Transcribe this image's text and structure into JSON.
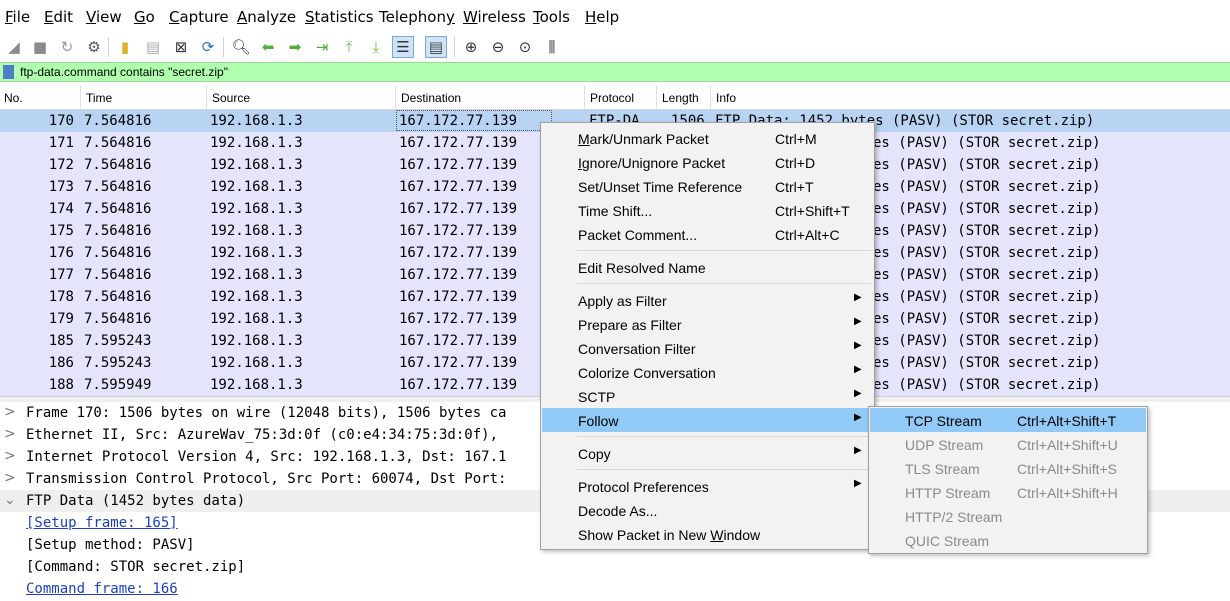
{
  "menubar": {
    "items": [
      {
        "pre": "",
        "ul": "F",
        "post": "ile"
      },
      {
        "pre": "",
        "ul": "E",
        "post": "dit"
      },
      {
        "pre": "",
        "ul": "V",
        "post": "iew"
      },
      {
        "pre": "",
        "ul": "G",
        "post": "o"
      },
      {
        "pre": "",
        "ul": "C",
        "post": "apture"
      },
      {
        "pre": "",
        "ul": "A",
        "post": "nalyze"
      },
      {
        "pre": "",
        "ul": "S",
        "post": "tatistics"
      },
      {
        "pre": "Telephon",
        "ul": "y",
        "post": ""
      },
      {
        "pre": "",
        "ul": "W",
        "post": "ireless"
      },
      {
        "pre": "",
        "ul": "T",
        "post": "ools"
      },
      {
        "pre": "",
        "ul": "H",
        "post": "elp"
      }
    ]
  },
  "filter": {
    "value": "ftp-data.command contains \"secret.zip\""
  },
  "columns": {
    "no": "No.",
    "time": "Time",
    "source": "Source",
    "destination": "Destination",
    "protocol": "Protocol",
    "length": "Length",
    "info": "Info"
  },
  "packets": [
    {
      "no": "170",
      "time": "7.564816",
      "src": "192.168.1.3",
      "dst": "167.172.77.139",
      "proto": "FTP-DA...",
      "len": "1506",
      "info": "FTP Data: 1452 bytes (PASV) (STOR secret.zip)"
    },
    {
      "no": "171",
      "time": "7.564816",
      "src": "192.168.1.3",
      "dst": "167.172.77.139",
      "proto": "",
      "len": "",
      "info": "es (PASV) (STOR secret.zip)"
    },
    {
      "no": "172",
      "time": "7.564816",
      "src": "192.168.1.3",
      "dst": "167.172.77.139",
      "proto": "",
      "len": "",
      "info": "es (PASV) (STOR secret.zip)"
    },
    {
      "no": "173",
      "time": "7.564816",
      "src": "192.168.1.3",
      "dst": "167.172.77.139",
      "proto": "",
      "len": "",
      "info": "es (PASV) (STOR secret.zip)"
    },
    {
      "no": "174",
      "time": "7.564816",
      "src": "192.168.1.3",
      "dst": "167.172.77.139",
      "proto": "",
      "len": "",
      "info": "es (PASV) (STOR secret.zip)"
    },
    {
      "no": "175",
      "time": "7.564816",
      "src": "192.168.1.3",
      "dst": "167.172.77.139",
      "proto": "",
      "len": "",
      "info": "es (PASV) (STOR secret.zip)"
    },
    {
      "no": "176",
      "time": "7.564816",
      "src": "192.168.1.3",
      "dst": "167.172.77.139",
      "proto": "",
      "len": "",
      "info": "es (PASV) (STOR secret.zip)"
    },
    {
      "no": "177",
      "time": "7.564816",
      "src": "192.168.1.3",
      "dst": "167.172.77.139",
      "proto": "",
      "len": "",
      "info": "es (PASV) (STOR secret.zip)"
    },
    {
      "no": "178",
      "time": "7.564816",
      "src": "192.168.1.3",
      "dst": "167.172.77.139",
      "proto": "",
      "len": "",
      "info": "es (PASV) (STOR secret.zip)"
    },
    {
      "no": "179",
      "time": "7.564816",
      "src": "192.168.1.3",
      "dst": "167.172.77.139",
      "proto": "",
      "len": "",
      "info": "es (PASV) (STOR secret.zip)"
    },
    {
      "no": "185",
      "time": "7.595243",
      "src": "192.168.1.3",
      "dst": "167.172.77.139",
      "proto": "",
      "len": "",
      "info": "es (PASV) (STOR secret.zip)"
    },
    {
      "no": "186",
      "time": "7.595243",
      "src": "192.168.1.3",
      "dst": "167.172.77.139",
      "proto": "",
      "len": "",
      "info": "es (PASV) (STOR secret.zip)"
    },
    {
      "no": "188",
      "time": "7.595949",
      "src": "192.168.1.3",
      "dst": "167.172.77.139",
      "proto": "",
      "len": "",
      "info": "es (PASV) (STOR secret.zip)"
    }
  ],
  "details": [
    {
      "text": "Frame 170: 1506 bytes on wire (12048 bits), 1506 bytes ca"
    },
    {
      "text": "Ethernet II, Src: AzureWav_75:3d:0f (c0:e4:34:75:3d:0f),"
    },
    {
      "text": "Internet Protocol Version 4, Src: 192.168.1.3, Dst: 167.1"
    },
    {
      "text": "Transmission Control Protocol, Src Port: 60074, Dst Port:"
    },
    {
      "text": "FTP Data (1452 bytes data)"
    },
    {
      "text": "[Setup frame: 165]"
    },
    {
      "text": "[Setup method: PASV]"
    },
    {
      "text": "[Command: STOR secret.zip]"
    },
    {
      "text": "Command frame: 166"
    }
  ],
  "context_menu": {
    "mark": {
      "pre": "",
      "ul": "M",
      "post": "ark/Unmark Packet",
      "shortcut": "Ctrl+M"
    },
    "ignore": {
      "pre": "",
      "ul": "I",
      "post": "gnore/Unignore Packet",
      "shortcut": "Ctrl+D"
    },
    "time_ref": {
      "label": "Set/Unset Time Reference",
      "shortcut": "Ctrl+T"
    },
    "time_shift": {
      "label": "Time Shift...",
      "shortcut": "Ctrl+Shift+T"
    },
    "comment": {
      "label": "Packet Comment...",
      "shortcut": "Ctrl+Alt+C"
    },
    "edit_resolved": {
      "label": "Edit Resolved Name"
    },
    "apply_filter": {
      "label": "Apply as Filter"
    },
    "prepare_filter": {
      "label": "Prepare as Filter"
    },
    "conv_filter": {
      "label": "Conversation Filter"
    },
    "colorize": {
      "label": "Colorize Conversation"
    },
    "sctp": {
      "label": "SCTP"
    },
    "follow": {
      "label": "Follow"
    },
    "copy": {
      "label": "Copy"
    },
    "proto_prefs": {
      "label": "Protocol Preferences"
    },
    "decode_as": {
      "label": "Decode As..."
    },
    "show_new_window": {
      "pre": "Show Packet in New ",
      "ul": "W",
      "post": "indow"
    }
  },
  "follow_submenu": [
    {
      "label": "TCP Stream",
      "shortcut": "Ctrl+Alt+Shift+T",
      "enabled": true
    },
    {
      "label": "UDP Stream",
      "shortcut": "Ctrl+Alt+Shift+U",
      "enabled": false
    },
    {
      "label": "TLS Stream",
      "shortcut": "Ctrl+Alt+Shift+S",
      "enabled": false
    },
    {
      "label": "HTTP Stream",
      "shortcut": "Ctrl+Alt+Shift+H",
      "enabled": false
    },
    {
      "label": "HTTP/2 Stream",
      "shortcut": "",
      "enabled": false
    },
    {
      "label": "QUIC Stream",
      "shortcut": "",
      "enabled": false
    }
  ],
  "icons": {
    "toolbar": [
      "shark-fin-start-icon",
      "stop-capture-icon",
      "restart-capture-icon",
      "capture-options-icon",
      "open-file-icon",
      "save-file-icon",
      "close-file-icon",
      "reload-file-icon",
      "find-packet-icon",
      "go-back-icon",
      "go-forward-icon",
      "go-to-packet-icon",
      "go-first-icon",
      "go-last-icon",
      "auto-scroll-icon",
      "colorize-icon",
      "zoom-in-icon",
      "zoom-out-icon",
      "zoom-normal-icon",
      "resize-columns-icon"
    ]
  },
  "colors": {
    "filter_bg": "#afffaf",
    "row_bg": "#e4e4fb",
    "selected_row": "#b8d4f2",
    "menu_highlight": "#91c9f7"
  }
}
